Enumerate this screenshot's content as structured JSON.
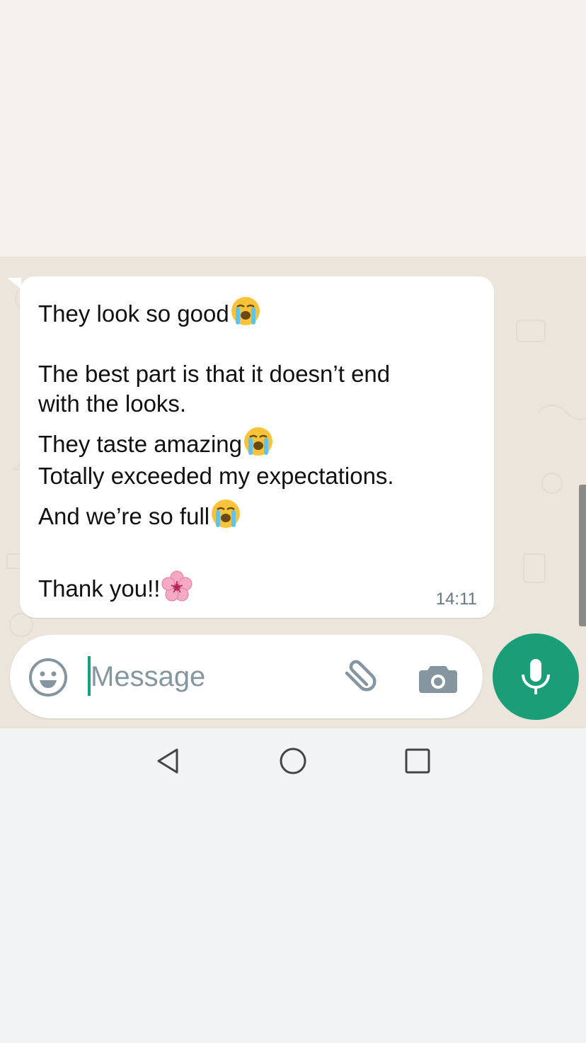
{
  "message": {
    "lines": [
      "They look so good",
      "The best part is that it doesn’t end",
      "with the looks.",
      "They taste amazing",
      "Totally exceeded my expectations.",
      "And we’re so full",
      "Thank you!!"
    ],
    "time": "14:11",
    "emoji_names": [
      "loudly-crying-face",
      "cherry-blossom"
    ]
  },
  "input": {
    "placeholder": "Message",
    "value": ""
  },
  "icons": {
    "emoji": "emoji-smiley-icon",
    "attach": "paperclip-icon",
    "camera": "camera-icon",
    "mic": "microphone-icon",
    "back": "back-triangle-icon",
    "home": "home-circle-icon",
    "recents": "recents-square-icon"
  },
  "colors": {
    "accent": "#00a884",
    "bubble": "#ffffff",
    "chat_background": "#ece5dc",
    "icon_gray": "#8696a0",
    "timestamp": "#667781"
  }
}
